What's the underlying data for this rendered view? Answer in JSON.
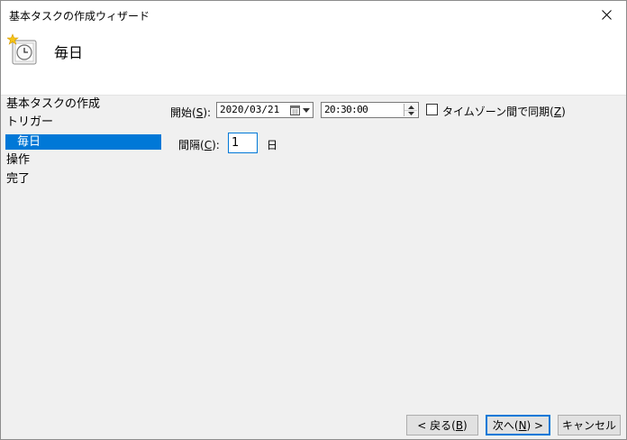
{
  "window": {
    "title": "基本タスクの作成ウィザード"
  },
  "header": {
    "title": "毎日",
    "icon": "calendar-clock-icon"
  },
  "nav": {
    "items": [
      {
        "label": "基本タスクの作成"
      },
      {
        "label": "トリガー"
      },
      {
        "label": "毎日",
        "selected": true
      },
      {
        "label": "操作"
      },
      {
        "label": "完了"
      }
    ]
  },
  "form": {
    "start_label": "開始(",
    "start_accel": "S",
    "start_label_end": "):",
    "start_date": "2020/03/21",
    "start_time": "20:30:00",
    "timezone_sync_label": "タイムゾーン間で同期(",
    "timezone_sync_accel": "Z",
    "timezone_sync_end": ")",
    "timezone_sync_checked": false,
    "interval_label": "間隔(",
    "interval_accel": "C",
    "interval_label_end": "):",
    "interval_value": "1",
    "interval_unit": "日"
  },
  "buttons": {
    "back_label": "< 戻る(",
    "back_accel": "B",
    "back_end": ")",
    "next_label": "次へ(",
    "next_accel": "N",
    "next_end": ") >",
    "cancel_label": "キャンセル"
  },
  "colors": {
    "selection": "#0078d7",
    "background": "#f0f0f0"
  }
}
